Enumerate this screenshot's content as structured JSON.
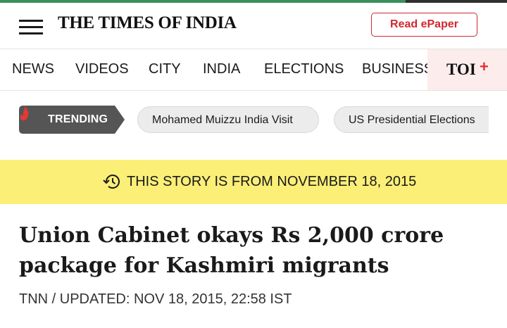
{
  "reading_progress": 0.8,
  "colors": {
    "brand_red": "#d1282e",
    "banner_yellow": "#fbef78",
    "trending_dark": "#555555"
  },
  "header": {
    "menu_icon": "hamburger-menu-icon",
    "logo": "THE TIMES OF INDIA",
    "epaper_label": "Read ePaper"
  },
  "nav": {
    "items": [
      "NEWS",
      "VIDEOS",
      "CITY",
      "INDIA",
      "ELECTIONS",
      "BUSINESS"
    ],
    "toiplus_text": "TOI",
    "toiplus_plus": "+"
  },
  "trending": {
    "icon": "flame-icon",
    "label": "TRENDING",
    "chips": [
      "Mohamed Muizzu India Visit",
      "US Presidential Elections"
    ]
  },
  "archive_banner": {
    "icon": "history-clock-icon",
    "text": "THIS STORY IS FROM NOVEMBER 18, 2015"
  },
  "article": {
    "headline": "Union Cabinet okays Rs 2,000 crore package for Kashmiri migrants",
    "byline": "TNN / UPDATED: NOV 18, 2015, 22:58 IST"
  }
}
